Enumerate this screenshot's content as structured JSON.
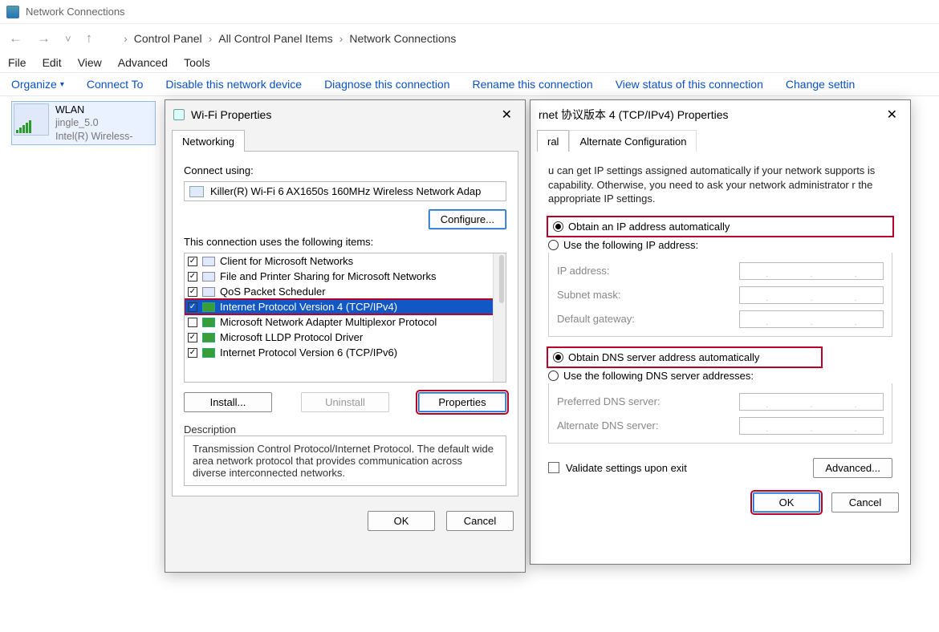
{
  "window": {
    "title": "Network Connections",
    "breadcrumbs": [
      "Control Panel",
      "All Control Panel Items",
      "Network Connections"
    ]
  },
  "menu": {
    "file": "File",
    "edit": "Edit",
    "view": "View",
    "advanced": "Advanced",
    "tools": "Tools"
  },
  "toolbar": {
    "organize": "Organize",
    "connect_to": "Connect To",
    "disable": "Disable this network device",
    "diagnose": "Diagnose this connection",
    "rename": "Rename this connection",
    "view_status": "View status of this connection",
    "change_settings": "Change settin"
  },
  "adapter": {
    "name": "WLAN",
    "ssid": "jingle_5.0",
    "device": "Intel(R) Wireless-"
  },
  "wifi_dialog": {
    "title": "Wi-Fi Properties",
    "tab": "Networking",
    "connect_using": "Connect using:",
    "nic": "Killer(R) Wi-Fi 6 AX1650s 160MHz Wireless Network Adap",
    "configure": "Configure...",
    "items_label": "This connection uses the following items:",
    "items": [
      {
        "checked": true,
        "label": "Client for Microsoft Networks",
        "selected": false
      },
      {
        "checked": true,
        "label": "File and Printer Sharing for Microsoft Networks",
        "selected": false
      },
      {
        "checked": true,
        "label": "QoS Packet Scheduler",
        "selected": false
      },
      {
        "checked": true,
        "label": "Internet Protocol Version 4 (TCP/IPv4)",
        "selected": true
      },
      {
        "checked": false,
        "label": "Microsoft Network Adapter Multiplexor Protocol",
        "selected": false
      },
      {
        "checked": true,
        "label": "Microsoft LLDP Protocol Driver",
        "selected": false
      },
      {
        "checked": true,
        "label": "Internet Protocol Version 6 (TCP/IPv6)",
        "selected": false
      }
    ],
    "install": "Install...",
    "uninstall": "Uninstall",
    "properties": "Properties",
    "description_label": "Description",
    "description": "Transmission Control Protocol/Internet Protocol. The default wide area network protocol that provides communication across diverse interconnected networks.",
    "ok": "OK",
    "cancel": "Cancel"
  },
  "ipv4_dialog": {
    "title_suffix": "rnet 协议版本 4 (TCP/IPv4) Properties",
    "tab_general": "ral",
    "tab_alt": "Alternate Configuration",
    "note": "u can get IP settings assigned automatically if your network supports is capability. Otherwise, you need to ask your network administrator r the appropriate IP settings.",
    "obtain_ip": "Obtain an IP address automatically",
    "use_ip": "Use the following IP address:",
    "ip_address": "IP address:",
    "subnet": "Subnet mask:",
    "gateway": "Default gateway:",
    "obtain_dns": "Obtain DNS server address automatically",
    "use_dns": "Use the following DNS server addresses:",
    "pref_dns": "Preferred DNS server:",
    "alt_dns": "Alternate DNS server:",
    "validate": "Validate settings upon exit",
    "advanced": "Advanced...",
    "ok": "OK",
    "cancel": "Cancel"
  }
}
